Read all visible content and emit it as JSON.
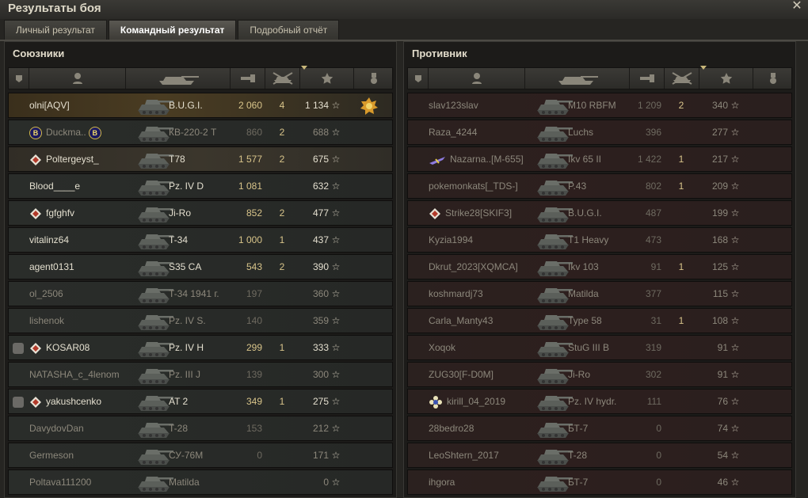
{
  "window": {
    "title": "Результаты боя"
  },
  "tabs": [
    {
      "label": "Личный результат",
      "active": false
    },
    {
      "label": "Командный результат",
      "active": true
    },
    {
      "label": "Подробный отчёт",
      "active": false
    }
  ],
  "star": "☆",
  "allies": {
    "title": "Союзники",
    "rows": [
      {
        "name": "olni[AQV]",
        "tank": "B.U.G.I.",
        "damage": "2 060",
        "frags": "4",
        "xp": "1 134",
        "state": "alive",
        "style": "me",
        "medal": true
      },
      {
        "name": "Duckma..",
        "tank": "КВ-220-2 Т",
        "damage": "860",
        "frags": "2",
        "xp": "688",
        "state": "dead",
        "prefix": "b",
        "suffix": "b"
      },
      {
        "name": "Poltergeyst_",
        "tank": "T78",
        "damage": "1 577",
        "frags": "2",
        "xp": "675",
        "state": "alive",
        "style": "hl",
        "prefix": "diamond"
      },
      {
        "name": "Blood____e",
        "tank": "Pz. IV D",
        "damage": "1 081",
        "frags": "",
        "xp": "632",
        "state": "alive"
      },
      {
        "name": "fgfghfv",
        "tank": "Ji-Ro",
        "damage": "852",
        "frags": "2",
        "xp": "477",
        "state": "alive",
        "prefix": "diamond"
      },
      {
        "name": "vitalinz64",
        "tank": "T-34",
        "damage": "1 000",
        "frags": "1",
        "xp": "437",
        "state": "alive"
      },
      {
        "name": "agent0131",
        "tank": "S35 CA",
        "damage": "543",
        "frags": "2",
        "xp": "390",
        "state": "alive"
      },
      {
        "name": "ol_2506",
        "tank": "T-34 1941 г.",
        "damage": "197",
        "frags": "",
        "xp": "360",
        "state": "dead"
      },
      {
        "name": "lishenok",
        "tank": "Pz. IV S.",
        "damage": "140",
        "frags": "",
        "xp": "359",
        "state": "dead"
      },
      {
        "name": "KOSAR08",
        "tank": "Pz. IV H",
        "damage": "299",
        "frags": "1",
        "xp": "333",
        "state": "alive",
        "prefix": "diamond",
        "platoon": "I"
      },
      {
        "name": "NATASHA_c_4lenom",
        "tank": "Pz. III J",
        "damage": "139",
        "frags": "",
        "xp": "300",
        "state": "dead"
      },
      {
        "name": "yakushcenko",
        "tank": "AT 2",
        "damage": "349",
        "frags": "1",
        "xp": "275",
        "state": "alive",
        "prefix": "diamond",
        "platoon": "I"
      },
      {
        "name": "DavydovDan",
        "tank": "T-28",
        "damage": "153",
        "frags": "",
        "xp": "212",
        "state": "dead"
      },
      {
        "name": "Germeson",
        "tank": "СУ-76М",
        "damage": "0",
        "frags": "",
        "xp": "171",
        "state": "dead"
      },
      {
        "name": "Poltava111200",
        "tank": "Matilda",
        "damage": "",
        "frags": "",
        "xp": "0",
        "state": "dead"
      }
    ]
  },
  "enemies": {
    "title": "Противник",
    "rows": [
      {
        "name": "slav123slav",
        "tank": "M10 RBFM",
        "damage": "1 209",
        "frags": "2",
        "xp": "340",
        "state": "dead"
      },
      {
        "name": "Raza_4244",
        "tank": "Luchs",
        "damage": "396",
        "frags": "",
        "xp": "277",
        "state": "dead"
      },
      {
        "name": "Nazarna..[M-655]",
        "tank": "Ikv 65 II",
        "damage": "1 422",
        "frags": "1",
        "xp": "217",
        "state": "dead",
        "prefix": "plane"
      },
      {
        "name": "pokemonkats[_TDS-]",
        "tank": "P.43",
        "damage": "802",
        "frags": "1",
        "xp": "209",
        "state": "dead"
      },
      {
        "name": "Strike28[SKIF3]",
        "tank": "B.U.G.I.",
        "damage": "487",
        "frags": "",
        "xp": "199",
        "state": "dead",
        "prefix": "diamond"
      },
      {
        "name": "Kyzia1994",
        "tank": "T1 Heavy",
        "damage": "473",
        "frags": "",
        "xp": "168",
        "state": "dead"
      },
      {
        "name": "Dkrut_2023[XQMCA]",
        "tank": "Ikv 103",
        "damage": "91",
        "frags": "1",
        "xp": "125",
        "state": "dead"
      },
      {
        "name": "koshmardj73",
        "tank": "Matilda",
        "damage": "377",
        "frags": "",
        "xp": "115",
        "state": "dead"
      },
      {
        "name": "Carla_Manty43",
        "tank": "Type 58",
        "damage": "31",
        "frags": "1",
        "xp": "108",
        "state": "dead"
      },
      {
        "name": "Xoqok",
        "tank": "StuG III B",
        "damage": "319",
        "frags": "",
        "xp": "91",
        "state": "dead"
      },
      {
        "name": "ZUG30[F-D0M]",
        "tank": "Ji-Ro",
        "damage": "302",
        "frags": "",
        "xp": "91",
        "state": "dead"
      },
      {
        "name": "kirill_04_2019",
        "tank": "Pz. IV hydr.",
        "damage": "111",
        "frags": "",
        "xp": "76",
        "state": "dead",
        "prefix": "flower"
      },
      {
        "name": "28bedro28",
        "tank": "БТ-7",
        "damage": "0",
        "frags": "",
        "xp": "74",
        "state": "dead"
      },
      {
        "name": "LeoShtern_2017",
        "tank": "T-28",
        "damage": "0",
        "frags": "",
        "xp": "54",
        "state": "dead"
      },
      {
        "name": "ihgora",
        "tank": "БТ-7",
        "damage": "0",
        "frags": "",
        "xp": "46",
        "state": "dead"
      }
    ]
  }
}
